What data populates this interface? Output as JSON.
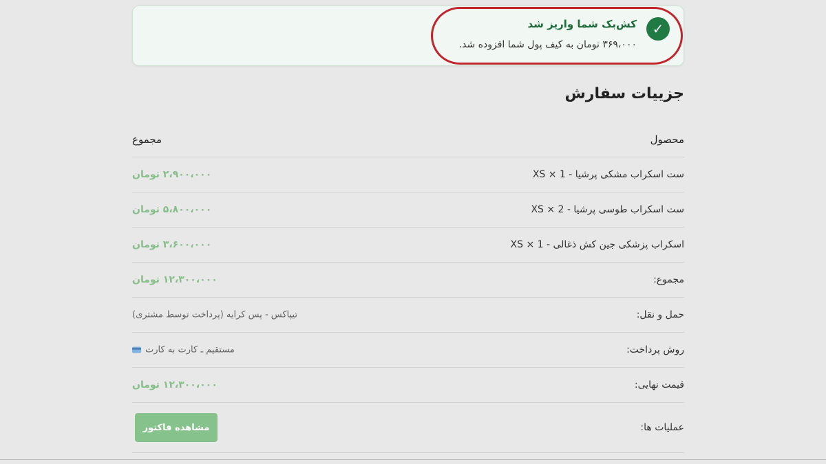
{
  "notice": {
    "icon": "check-icon",
    "title": "کش‌بک شما واریز شد",
    "message": "۳۶۹،۰۰۰ تومان به کیف پول شما افزوده شد."
  },
  "section_title": "جزییات سفارش",
  "table": {
    "headers": {
      "product": "محصول",
      "total": "مجموع"
    },
    "items": [
      {
        "name": "ست اسکراب مشکی پرشیا - XS × 1",
        "price": "۲،۹۰۰،۰۰۰ تومان"
      },
      {
        "name": "ست اسکراب طوسی پرشیا - XS × 2",
        "price": "۵،۸۰۰،۰۰۰ تومان"
      },
      {
        "name": "اسکراب پزشکی جین کش ذغالی - XS × 1",
        "price": "۳،۶۰۰،۰۰۰ تومان"
      }
    ],
    "subtotal": {
      "label": "مجموع:",
      "value": "۱۲،۳۰۰،۰۰۰ تومان"
    },
    "shipping": {
      "label": "حمل و نقل:",
      "value": "تیپاکس - پس کرایه (پرداخت توسط مشتری)"
    },
    "payment": {
      "label": "روش پرداخت:",
      "value": "مستقیم ـ کارت به کارت",
      "icon": "credit-card-icon"
    },
    "final": {
      "label": "قیمت نهایی:",
      "value": "۱۲،۳۰۰،۰۰۰ تومان"
    },
    "actions": {
      "label": "عملیات ها:",
      "button": "مشاهده فاکتور"
    }
  },
  "colors": {
    "success": "#1f7a43",
    "price": "#86be8a",
    "button": "#86c28b",
    "highlight": "#c0272d"
  }
}
